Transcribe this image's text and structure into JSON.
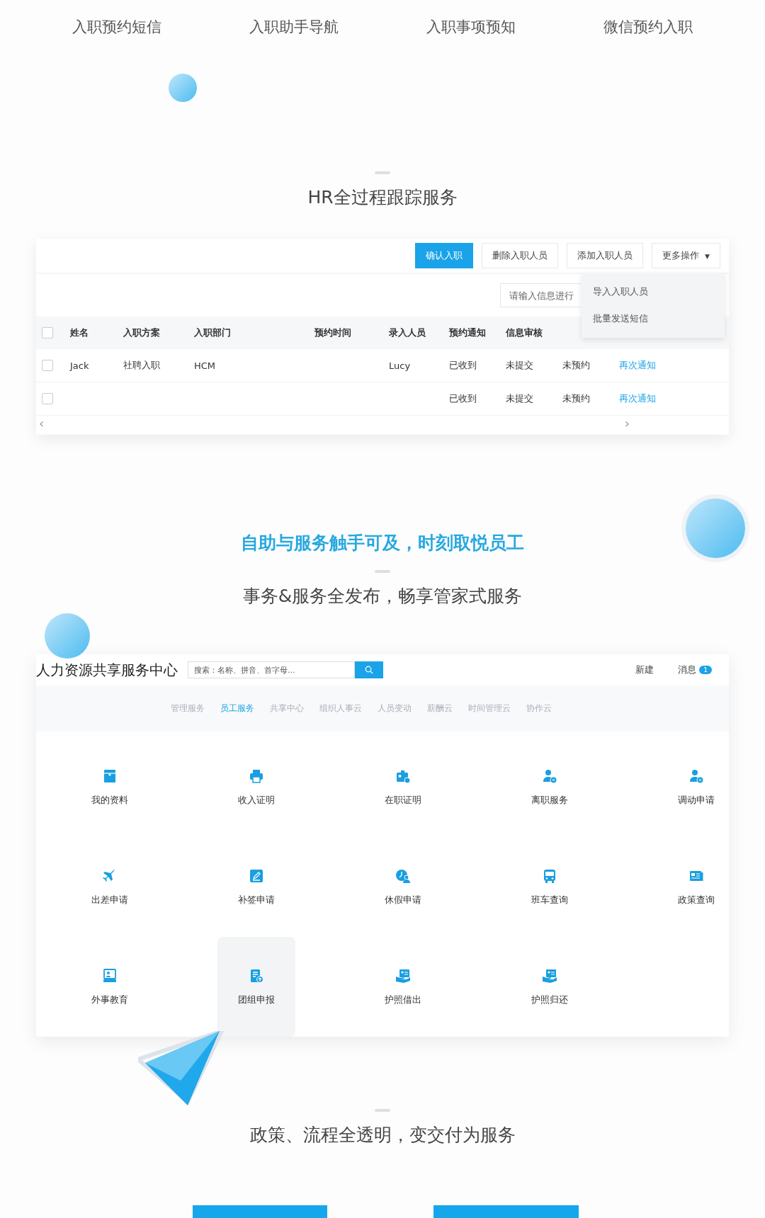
{
  "features": [
    "入职预约短信",
    "入职助手导航",
    "入职事项预知",
    "微信预约入职"
  ],
  "hr_section": {
    "title": "HR全过程跟踪服务",
    "toolbar": [
      {
        "label": "确认入职",
        "primary": true
      },
      {
        "label": "删除入职人员",
        "primary": false
      },
      {
        "label": "添加入职人员",
        "primary": false
      },
      {
        "label": "更多操作",
        "primary": false,
        "caret": "▼"
      }
    ],
    "search": {
      "placeholder": "请输入信息进行"
    },
    "dropdown": [
      "导入入职人员",
      "批量发送短信"
    ],
    "table": {
      "columns": [
        "姓名",
        "入职方案",
        "入职部门",
        "预约时间",
        "录入人员",
        "预约通知",
        "信息审核"
      ],
      "header_checked": false,
      "rows": [
        {
          "checked": false,
          "cells": [
            "Jack",
            "社聘入职",
            "HCM",
            null,
            "Lucy",
            "已收到",
            "未提交",
            "未预约",
            "再次通知"
          ]
        },
        {
          "checked": false,
          "cells": [
            null,
            null,
            null,
            null,
            null,
            "已收到",
            "未提交",
            "未预约",
            "再次通知"
          ]
        }
      ],
      "scroll": {
        "left": "‹",
        "right": "›"
      }
    }
  },
  "self_service": {
    "headline": "自助与服务触手可及，时刻取悦员工",
    "subtitle": "事务&服务全发布，畅享管家式服务"
  },
  "portal": {
    "title": "人力资源共享服务中心",
    "search": {
      "placeholder": "搜索：名称、拼音、首字母..."
    },
    "new": "新建",
    "messages": {
      "label": "消息",
      "badge": "1"
    },
    "tabs": [
      {
        "label": "管理服务",
        "selected": false
      },
      {
        "label": "员工服务",
        "selected": true
      },
      {
        "label": "共享中心",
        "selected": false
      },
      {
        "label": "组织人事云",
        "selected": false
      },
      {
        "label": "人员变动",
        "selected": false
      },
      {
        "label": "薪酬云",
        "selected": false
      },
      {
        "label": "时间管理云",
        "selected": false
      },
      {
        "label": "协作云",
        "selected": false
      }
    ],
    "tiles": [
      {
        "label": "我的资料",
        "hovered": false
      },
      {
        "label": "收入证明",
        "hovered": false
      },
      {
        "label": "在职证明",
        "hovered": false
      },
      {
        "label": "离职服务",
        "hovered": false
      },
      {
        "label": "调动申请",
        "hovered": false
      },
      {
        "label": "出差申请",
        "hovered": false
      },
      {
        "label": "补签申请",
        "hovered": false
      },
      {
        "label": "休假申请",
        "hovered": false
      },
      {
        "label": "班车查询",
        "hovered": false
      },
      {
        "label": "政策查询",
        "hovered": false
      },
      {
        "label": "外事教育",
        "hovered": false
      },
      {
        "label": "团组申报",
        "hovered": true
      },
      {
        "label": "护照借出",
        "hovered": false
      },
      {
        "label": "护照归还",
        "hovered": false
      }
    ]
  },
  "policy": {
    "title": "政策、流程全透明，变交付为服务"
  }
}
